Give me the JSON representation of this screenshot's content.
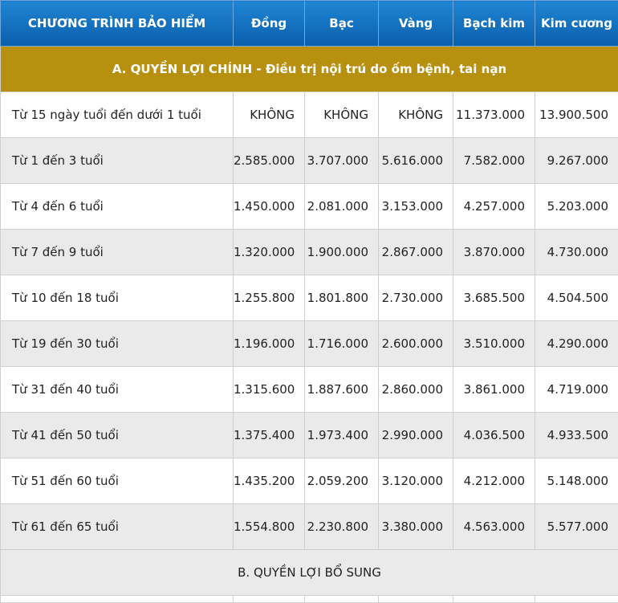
{
  "header": {
    "program": "CHƯƠNG TRÌNH BẢO HIỂM",
    "plans": [
      "Đồng",
      "Bạc",
      "Vàng",
      "Bạch kim",
      "Kim cương"
    ]
  },
  "section_a": "A. QUYỀN LỢI CHÍNH - Điều trị nội trú do ốm bệnh, tai nạn",
  "rows": [
    {
      "label": "Từ 15 ngày tuổi đến dưới 1 tuổi",
      "values": [
        "KHÔNG",
        "KHÔNG",
        "KHÔNG",
        "11.373.000",
        "13.900.500"
      ]
    },
    {
      "label": "Từ 1 đến 3 tuổi",
      "values": [
        "2.585.000",
        "3.707.000",
        "5.616.000",
        "7.582.000",
        "9.267.000"
      ]
    },
    {
      "label": "Từ  4 đến 6 tuổi",
      "values": [
        "1.450.000",
        "2.081.000",
        "3.153.000",
        "4.257.000",
        "5.203.000"
      ]
    },
    {
      "label": "Từ 7 đến 9 tuổi",
      "values": [
        "1.320.000",
        "1.900.000",
        "2.867.000",
        "3.870.000",
        "4.730.000"
      ]
    },
    {
      "label": "Từ 10 đến 18 tuổi",
      "values": [
        "1.255.800",
        "1.801.800",
        "2.730.000",
        "3.685.500",
        "4.504.500"
      ]
    },
    {
      "label": "Từ 19 đến 30 tuổi",
      "values": [
        "1.196.000",
        "1.716.000",
        "2.600.000",
        "3.510.000",
        "4.290.000"
      ]
    },
    {
      "label": "Từ 31 đến 40 tuổi",
      "values": [
        "1.315.600",
        "1.887.600",
        "2.860.000",
        "3.861.000",
        "4.719.000"
      ]
    },
    {
      "label": "Từ 41 đến 50 tuổi",
      "values": [
        "1.375.400",
        "1.973.400",
        "2.990.000",
        "4.036.500",
        "4.933.500"
      ]
    },
    {
      "label": "Từ 51 đến 60 tuổi",
      "values": [
        "1.435.200",
        "2.059.200",
        "3.120.000",
        "4.212.000",
        "5.148.000"
      ]
    },
    {
      "label": "Từ 61 đến 65 tuổi",
      "values": [
        "1.554.800",
        "2.230.800",
        "3.380.000",
        "4.563.000",
        "5.577.000"
      ]
    }
  ],
  "section_b": "B. QUYỀN LỢI BỔ SUNG",
  "colors": {
    "header_blue": "#0b5eac",
    "section_gold": "#b8900f",
    "row_shade": "#eaeaea"
  }
}
